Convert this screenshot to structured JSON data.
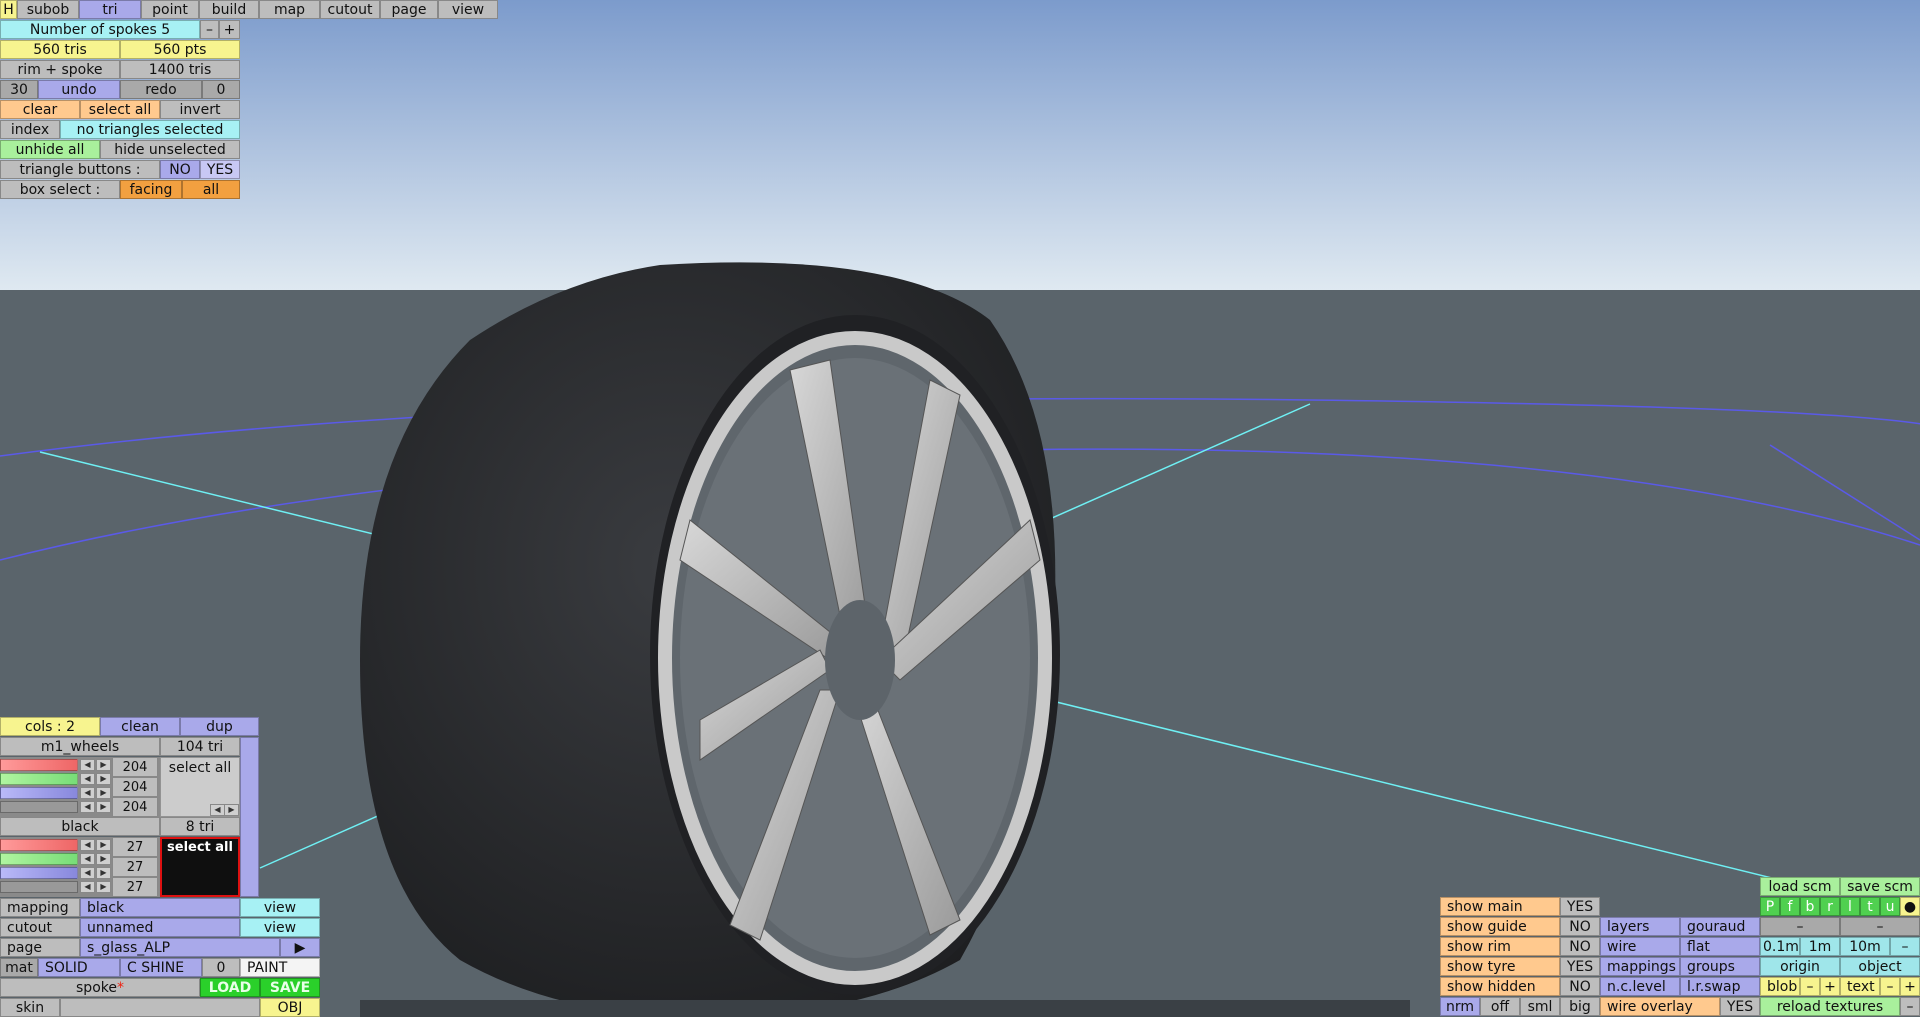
{
  "menu": {
    "h": "H",
    "tabs": [
      "subob",
      "tri",
      "point",
      "build",
      "map",
      "cutout",
      "page",
      "view"
    ]
  },
  "tri_panel": {
    "spokes_label": "Number of spokes 5",
    "minus": "–",
    "plus": "+",
    "tris": "560 tris",
    "pts": "560 pts",
    "rim_spoke": "rim + spoke",
    "rim_spoke_tris": "1400 tris",
    "count": "30",
    "undo": "undo",
    "redo": "redo",
    "redo_count": "0",
    "clear": "clear",
    "select_all": "select all",
    "invert": "invert",
    "index": "index",
    "selection_status": "no triangles selected",
    "unhide_all": "unhide all",
    "hide_unselected": "hide unselected",
    "triangle_buttons": "triangle buttons :",
    "no": "NO",
    "yes": "YES",
    "box_select": "box select :",
    "facing": "facing",
    "all": "all"
  },
  "colours_panel": {
    "cols": "cols : 2",
    "clean": "clean",
    "dup": "dup",
    "mat_name": "m1_wheels",
    "mat_tri": "104 tri",
    "rgb1": [
      "204",
      "204",
      "204"
    ],
    "select_all": "select all",
    "col2_name": "black",
    "col2_tri": "8 tri",
    "rgb2": [
      "27",
      "27",
      "27"
    ],
    "select_all_2": "select all",
    "mapping_label": "mapping",
    "mapping_value": "black",
    "cutout_label": "cutout",
    "cutout_value": "unnamed",
    "page_label": "page",
    "page_value": "s_glass_ALP",
    "view": "view",
    "play": "▶",
    "mat": "mat",
    "solid": "SOLID",
    "cshine": "C SHINE",
    "shine_val": "0",
    "paint": "PAINT",
    "part_name": "spoke",
    "star": "*",
    "load": "LOAD",
    "save": "SAVE",
    "skin": "skin",
    "obj": "OBJ"
  },
  "view_panel": {
    "load_scm": "load scm",
    "save_scm": "save scm",
    "views": [
      "P",
      "f",
      "b",
      "r",
      "l",
      "t",
      "u",
      "●"
    ],
    "show_main": "show main",
    "show_guide": "show guide",
    "show_rim": "show rim",
    "show_tyre": "show tyre",
    "show_hidden": "show hidden",
    "vals": [
      "YES",
      "NO",
      "NO",
      "YES",
      "NO"
    ],
    "layers": "layers",
    "gouraud": "gouraud",
    "wire": "wire",
    "flat": "flat",
    "mappings": "mappings",
    "groups": "groups",
    "nc_level": "n.c.level",
    "lr_swap": "l.r.swap",
    "dash": "–",
    "grid_01": "0.1m",
    "grid_1": "1m",
    "grid_10": "10m",
    "origin": "origin",
    "object": "object",
    "blob": "blob",
    "text": "text",
    "nrm": "nrm",
    "off": "off",
    "sml": "sml",
    "big": "big",
    "wire_overlay": "wire overlay",
    "wire_overlay_val": "YES",
    "reload_textures": "reload textures"
  },
  "colors": {
    "sky_top": "#7f9fcf",
    "sky_bottom": "#dde9f2",
    "ground": "#5a646b",
    "tyre": "#2a2c2f",
    "guide_line": "#6ff0f4",
    "rim_line": "#5a5ae8"
  }
}
